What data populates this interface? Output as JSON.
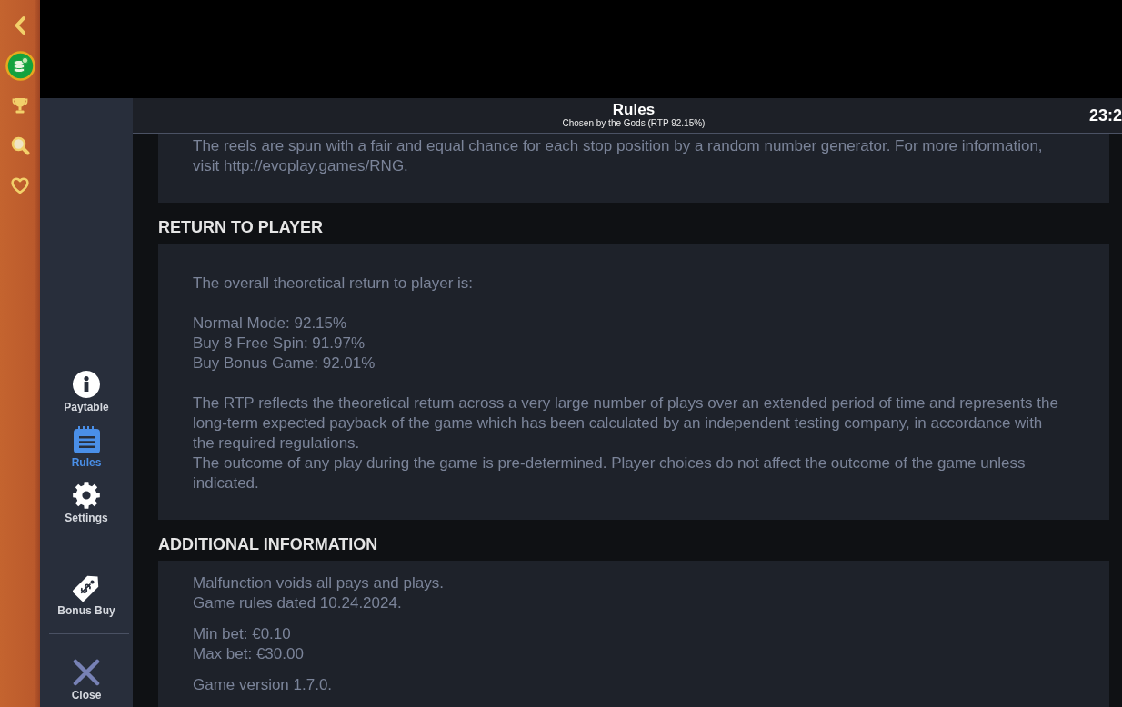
{
  "header": {
    "title": "Rules",
    "subtitle": "Chosen by the Gods (RTP 92.15%)",
    "clock": "23:2"
  },
  "sidebar": {
    "groups": [
      [
        {
          "kind": "info",
          "label": "Paytable",
          "selected": false
        },
        {
          "kind": "rules",
          "label": "Rules",
          "selected": true
        },
        {
          "kind": "settings",
          "label": "Settings",
          "selected": false
        }
      ],
      [
        {
          "kind": "bonus",
          "label": "Bonus Buy",
          "selected": false
        }
      ],
      [
        {
          "kind": "close",
          "label": "Close",
          "selected": false
        }
      ]
    ]
  },
  "sections": [
    {
      "kind": "compact",
      "blocks": [
        [
          "The reels are spun with a fair and equal chance for each stop position by a random number generator. For more information, visit http://evoplay.games/RNG."
        ]
      ]
    },
    {
      "heading": "RETURN TO PLAYER",
      "kind": "spaced",
      "blocks": [
        [
          "The overall theoretical return to player is:"
        ],
        [
          "Normal Mode: 92.15%",
          "Buy 8 Free Spin: 91.97%",
          "Buy Bonus Game: 92.01%"
        ],
        [
          "The RTP reflects the theoretical return across a very large number of plays over an extended period of time and represents the long-term expected payback of the game which has been calculated by an independent testing company, in accordance with the required regulations.",
          "The outcome of any play during the game is pre-determined. Player choices do not affect the outcome of the game unless indicated."
        ]
      ]
    },
    {
      "heading": "ADDITIONAL INFORMATION",
      "kind": "compact",
      "blocks": [
        [
          "Malfunction voids all pays and plays.",
          "Game rules dated 10.24.2024."
        ],
        [
          "Min bet: €0.10",
          "Max bet: €30.00"
        ],
        [
          "Game version 1.7.0."
        ]
      ]
    }
  ]
}
